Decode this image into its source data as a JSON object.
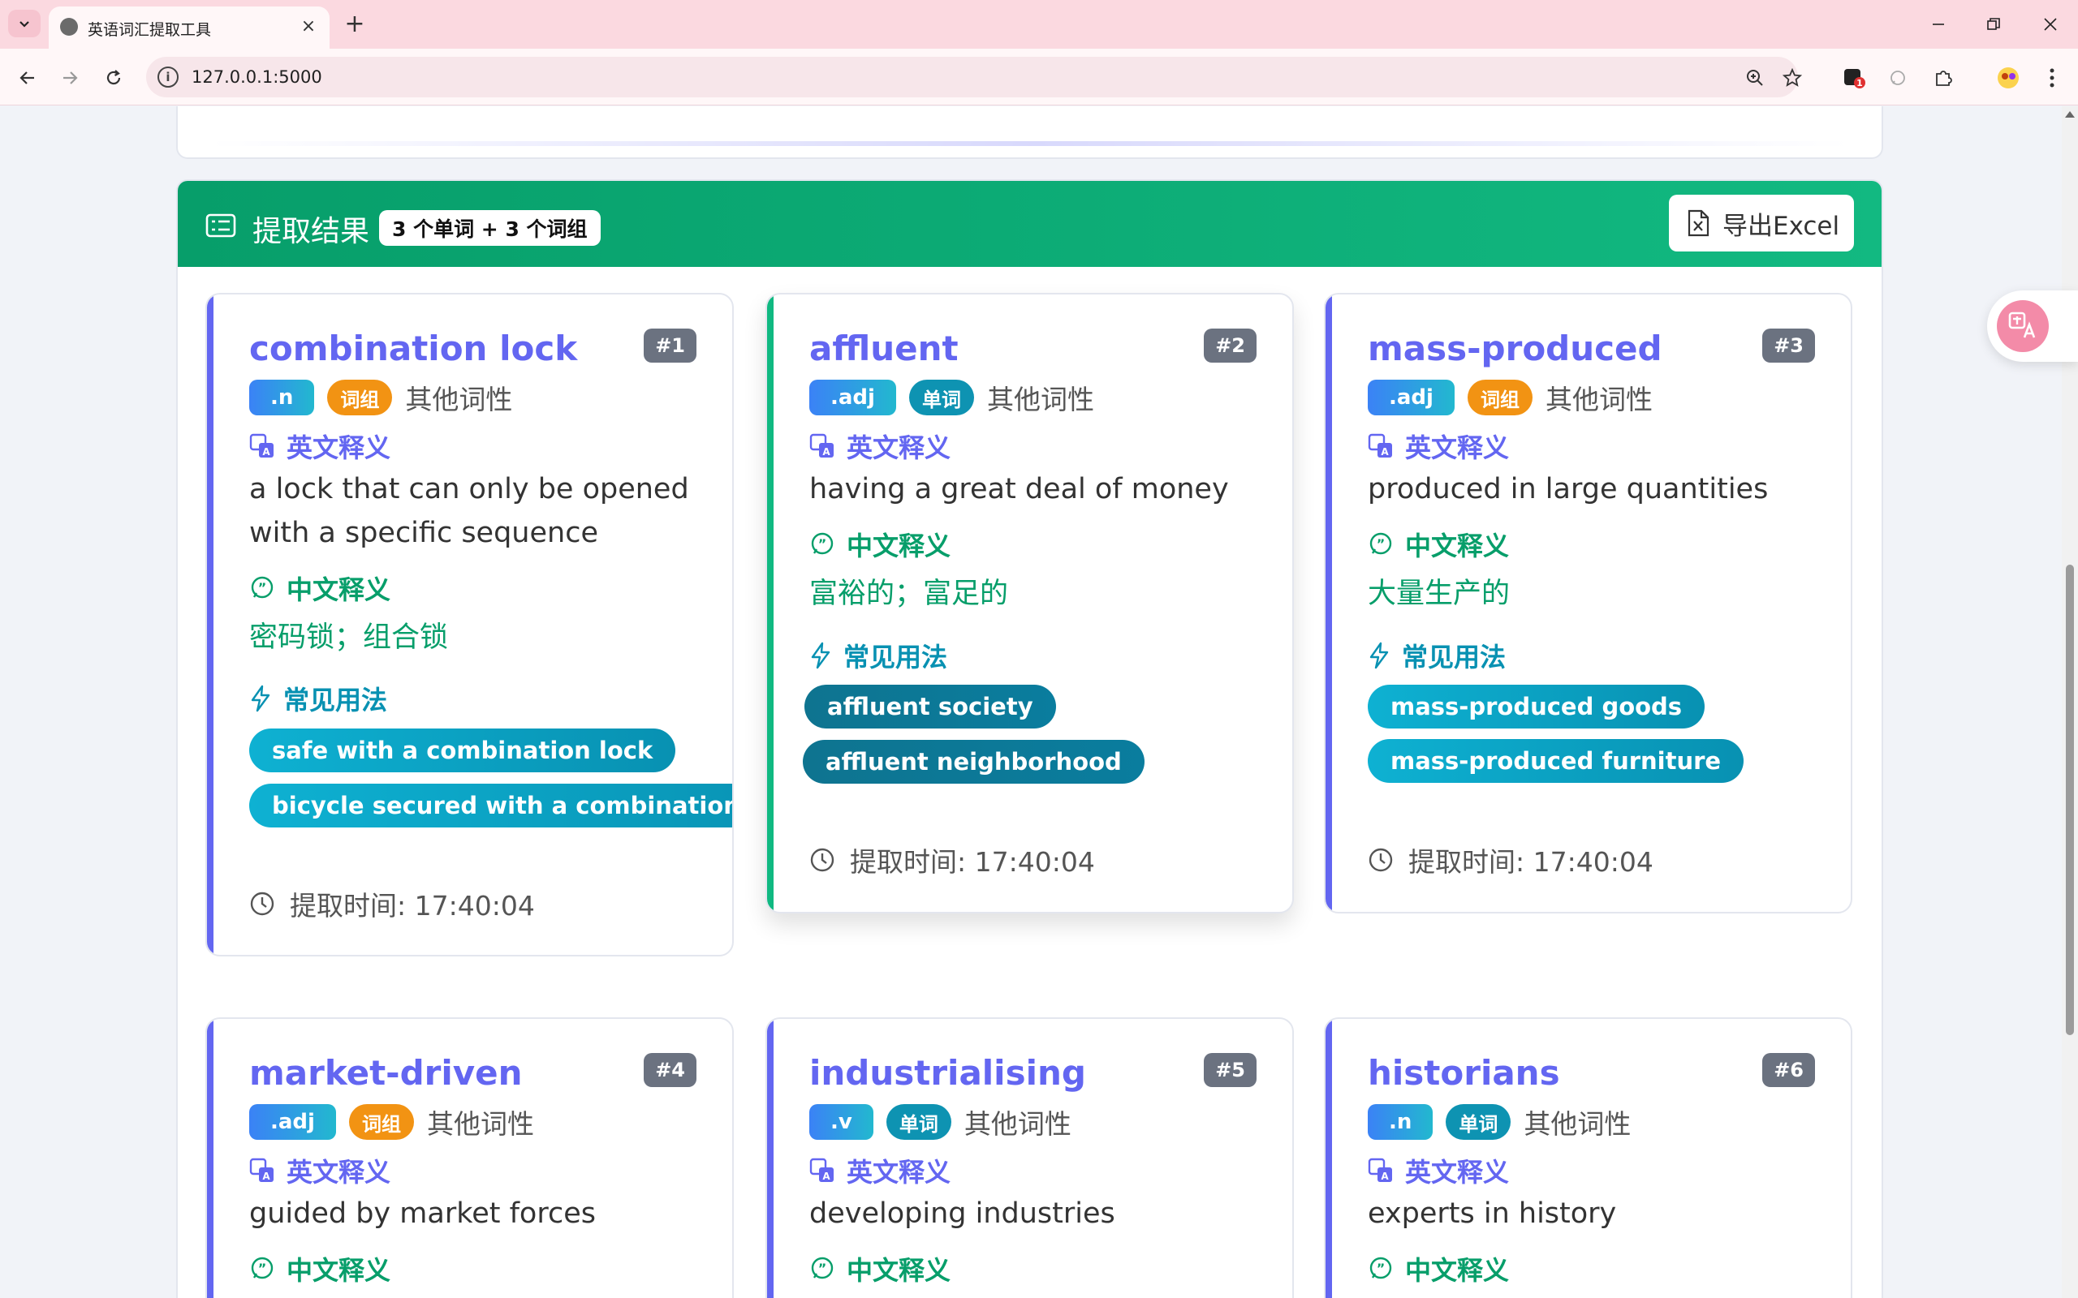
{
  "browser": {
    "tab_title": "英语词汇提取工具",
    "url": "127.0.0.1:5000",
    "ext_badge": "1"
  },
  "result": {
    "title": "提取结果",
    "count": "3 个单词 + 3 个词组",
    "export_label": "导出Excel"
  },
  "labels": {
    "english_def": "英文释义",
    "chinese_def": "中文释义",
    "usage": "常见用法",
    "other_pos": "其他词性"
  },
  "cards": [
    {
      "word": "combination lock",
      "index": "#1",
      "pos": ".n",
      "type": "词组",
      "english": "a lock that can only be opened with a specific sequence",
      "chinese": "密码锁；组合锁",
      "usages": [
        "safe with a combination lock",
        "bicycle secured with a combination lock"
      ],
      "time": "提取时间: 17:40:04"
    },
    {
      "word": "affluent",
      "index": "#2",
      "pos": ".adj",
      "type": "单词",
      "english": "having a great deal of money",
      "chinese": "富裕的；富足的",
      "usages": [
        "affluent society",
        "affluent neighborhood"
      ],
      "time": "提取时间: 17:40:04"
    },
    {
      "word": "mass-produced",
      "index": "#3",
      "pos": ".adj",
      "type": "词组",
      "english": "produced in large quantities",
      "chinese": "大量生产的",
      "usages": [
        "mass-produced goods",
        "mass-produced furniture"
      ],
      "time": "提取时间: 17:40:04"
    },
    {
      "word": "market-driven",
      "index": "#4",
      "pos": ".adj",
      "type": "词组",
      "english": "guided by market forces"
    },
    {
      "word": "industrialising",
      "index": "#5",
      "pos": ".v",
      "type": "单词",
      "english": "developing industries"
    },
    {
      "word": "historians",
      "index": "#6",
      "pos": ".n",
      "type": "单词",
      "english": "experts in history"
    }
  ],
  "colors": {
    "header_green": "#079e6a",
    "accent_purple": "#6366f1",
    "accent_green": "#10b981",
    "phrase_orange": "#f29313",
    "word_teal": "#0e93b2"
  }
}
